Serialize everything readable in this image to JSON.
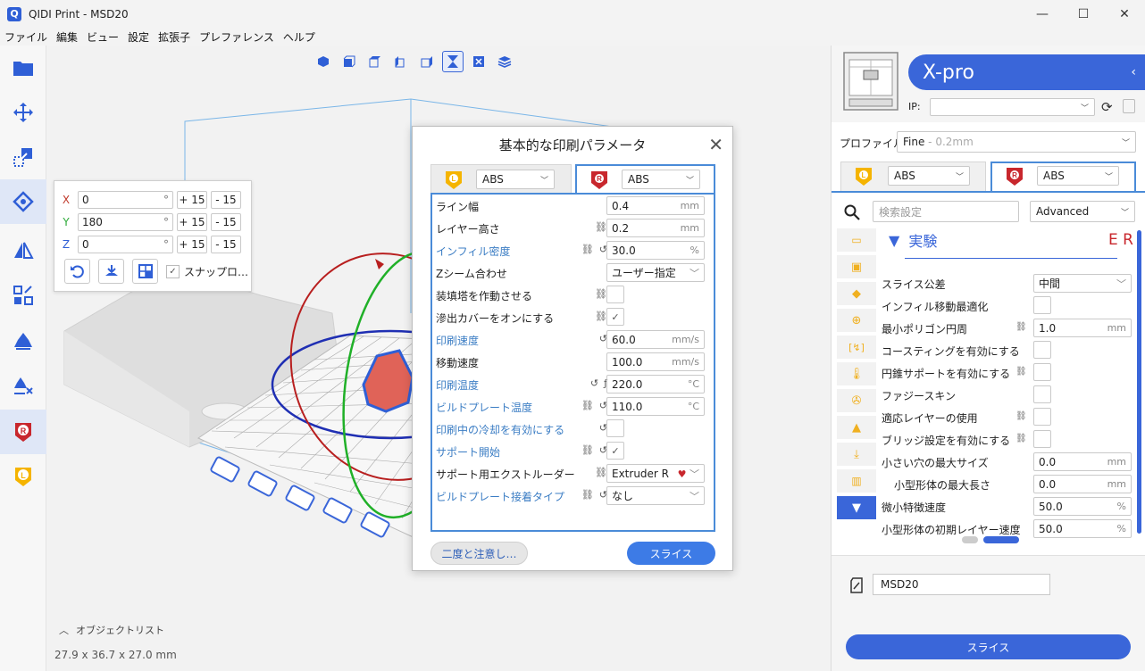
{
  "window": {
    "title": "QIDI Print - MSD20",
    "logo_letter": "Q"
  },
  "menu": [
    "ファイル",
    "編集",
    "ビュー",
    "設定",
    "拡張子",
    "プレファレンス",
    "ヘルプ"
  ],
  "rotate_panel": {
    "x_label": "X",
    "y_label": "Y",
    "z_label": "Z",
    "x_value": "0",
    "y_value": "180",
    "z_value": "0",
    "degree": "°",
    "plus": "+ 15",
    "minus": "- 15",
    "snap_label": "スナップロ…"
  },
  "viewport": {
    "object_list": "オブジェクトリスト",
    "dimensions": "27.9 x 36.7 x 27.0 mm"
  },
  "dialog": {
    "title": "基本的な印刷パラメータ",
    "left_material": "ABS",
    "right_material": "ABS",
    "rows": [
      {
        "label": "ライン幅",
        "value": "0.4",
        "unit": "mm"
      },
      {
        "label": "レイヤー高さ",
        "value": "0.2",
        "unit": "mm"
      },
      {
        "label": "インフィル密度",
        "value": "30.0",
        "unit": "%"
      },
      {
        "label": "Zシーム合わせ",
        "value": "ユーザー指定"
      },
      {
        "label": "装填塔を作動させる"
      },
      {
        "label": "滲出カバーをオンにする",
        "check": "✓"
      },
      {
        "label": "印刷速度",
        "value": "60.0",
        "unit": "mm/s"
      },
      {
        "label": "移動速度",
        "value": "100.0",
        "unit": "mm/s"
      },
      {
        "label": "印刷温度",
        "value": "220.0",
        "unit": "°C"
      },
      {
        "label": "ビルドプレート温度",
        "value": "110.0",
        "unit": "°C"
      },
      {
        "label": "印刷中の冷却を有効にする"
      },
      {
        "label": "サポート開始",
        "check": "✓"
      },
      {
        "label": "サポート用エクストルーダー",
        "value": "Extruder R"
      },
      {
        "label": "ビルドプレート接着タイプ",
        "value": "なし"
      }
    ],
    "btn_left": "二度と注意し…",
    "btn_right": "スライス"
  },
  "right_panel": {
    "printer_name": "X-pro",
    "ip_label": "IP:",
    "profile_label": "プロファイル",
    "profile_value": "Fine",
    "profile_sub": " - 0.2mm",
    "left_material": "ABS",
    "right_material": "ABS",
    "search_placeholder": "検索設定",
    "mode": "Advanced",
    "section_title": "実験",
    "section_tag": "E R",
    "rows": [
      {
        "label": "スライス公差",
        "value": "中間"
      },
      {
        "label": "インフィル移動最適化"
      },
      {
        "label": "最小ポリゴン円周",
        "value": "1.0",
        "unit": "mm"
      },
      {
        "label": "コースティングを有効にする"
      },
      {
        "label": "円錐サポートを有効にする"
      },
      {
        "label": "ファジースキン"
      },
      {
        "label": "適応レイヤーの使用"
      },
      {
        "label": "ブリッジ設定を有効にする"
      },
      {
        "label": "小さい穴の最大サイズ",
        "value": "0.0",
        "unit": "mm"
      },
      {
        "label": "小型形体の最大長さ",
        "value": "0.0",
        "unit": "mm"
      },
      {
        "label": "微小特徴速度",
        "value": "50.0",
        "unit": "%"
      },
      {
        "label": "小型形体の初期レイヤー速度",
        "value": "50.0",
        "unit": "%"
      }
    ],
    "job_name": "MSD20",
    "slice_btn": "スライス"
  },
  "colors": {
    "accent": "#3a66d9",
    "dialog_tab_blue": "#4a8bd8",
    "label_blue": "#3b7dc4",
    "extruder_red": "#c8272d",
    "extruder_yellow": "#f5b400"
  }
}
